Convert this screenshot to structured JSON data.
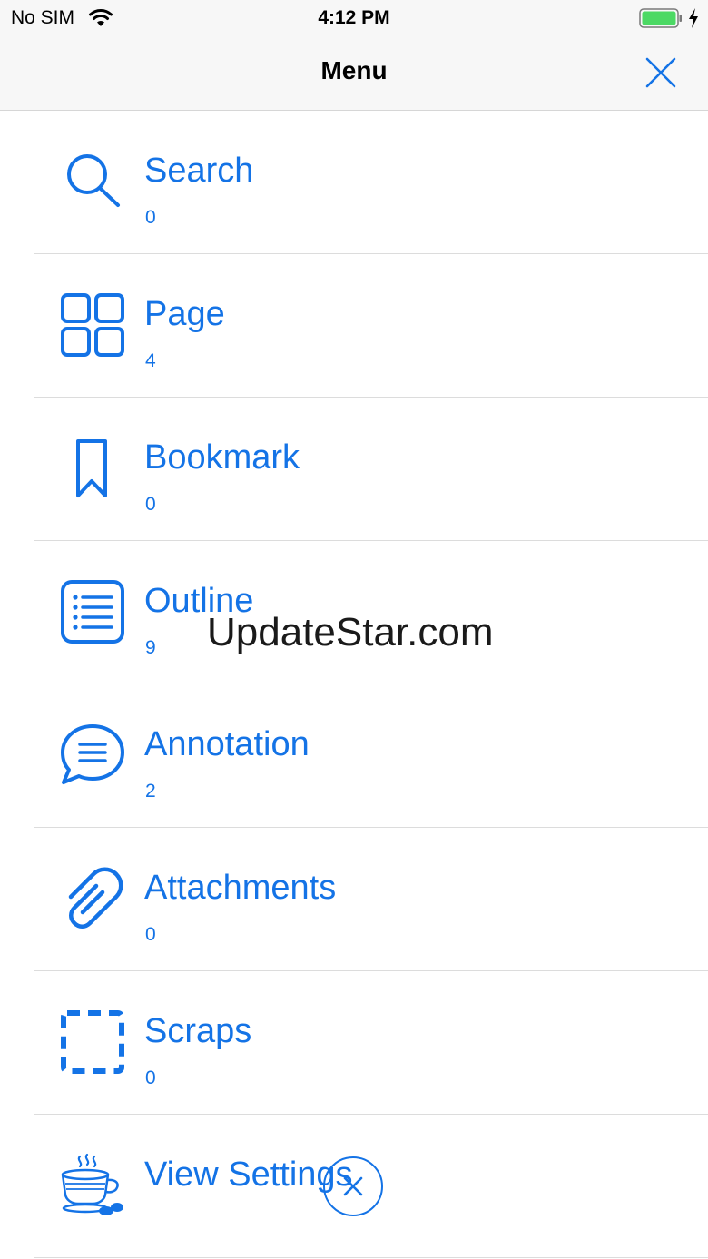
{
  "status_bar": {
    "carrier": "No SIM",
    "time": "4:12 PM",
    "battery_color": "#4cd964"
  },
  "nav": {
    "title": "Menu"
  },
  "accent_color": "#1473e6",
  "menu": {
    "items": [
      {
        "label": "Search",
        "count": "0",
        "icon": "search-icon"
      },
      {
        "label": "Page",
        "count": "4",
        "icon": "grid-icon"
      },
      {
        "label": "Bookmark",
        "count": "0",
        "icon": "bookmark-icon"
      },
      {
        "label": "Outline",
        "count": "9",
        "icon": "list-icon"
      },
      {
        "label": "Annotation",
        "count": "2",
        "icon": "speech-bubble-icon"
      },
      {
        "label": "Attachments",
        "count": "0",
        "icon": "paperclip-icon"
      },
      {
        "label": "Scraps",
        "count": "0",
        "icon": "dashed-square-icon"
      },
      {
        "label": "View Settings",
        "icon": "coffee-cup-icon"
      }
    ]
  },
  "watermark": "UpdateStar.com"
}
